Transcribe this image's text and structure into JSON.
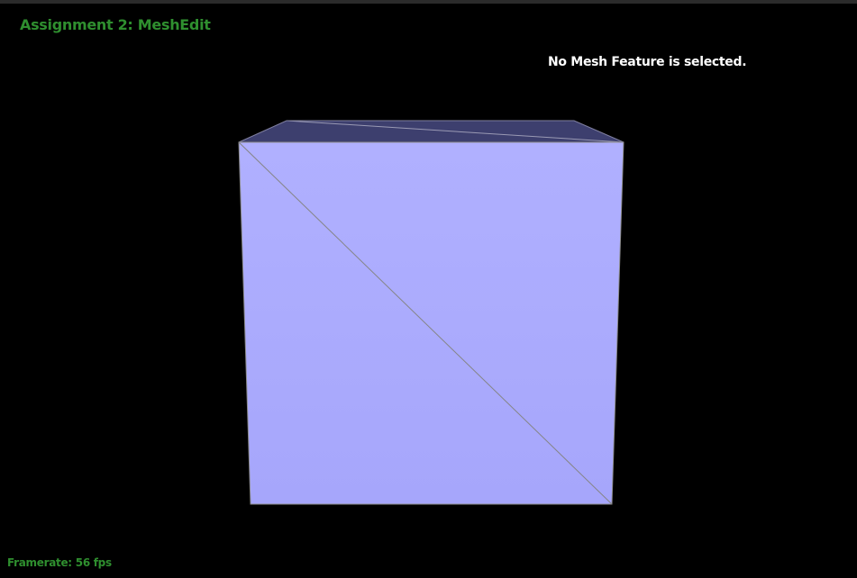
{
  "app": {
    "title": "Assignment 2: MeshEdit"
  },
  "status": {
    "message": "No Mesh Feature is selected."
  },
  "framerate": {
    "label": "Framerate:",
    "value": "56 fps"
  },
  "colors": {
    "background": "#000000",
    "title_green": "#2f8f2f",
    "front_face": "#aaaaff",
    "top_face": "#3d3f6e",
    "edge": "#8a8a8a"
  }
}
